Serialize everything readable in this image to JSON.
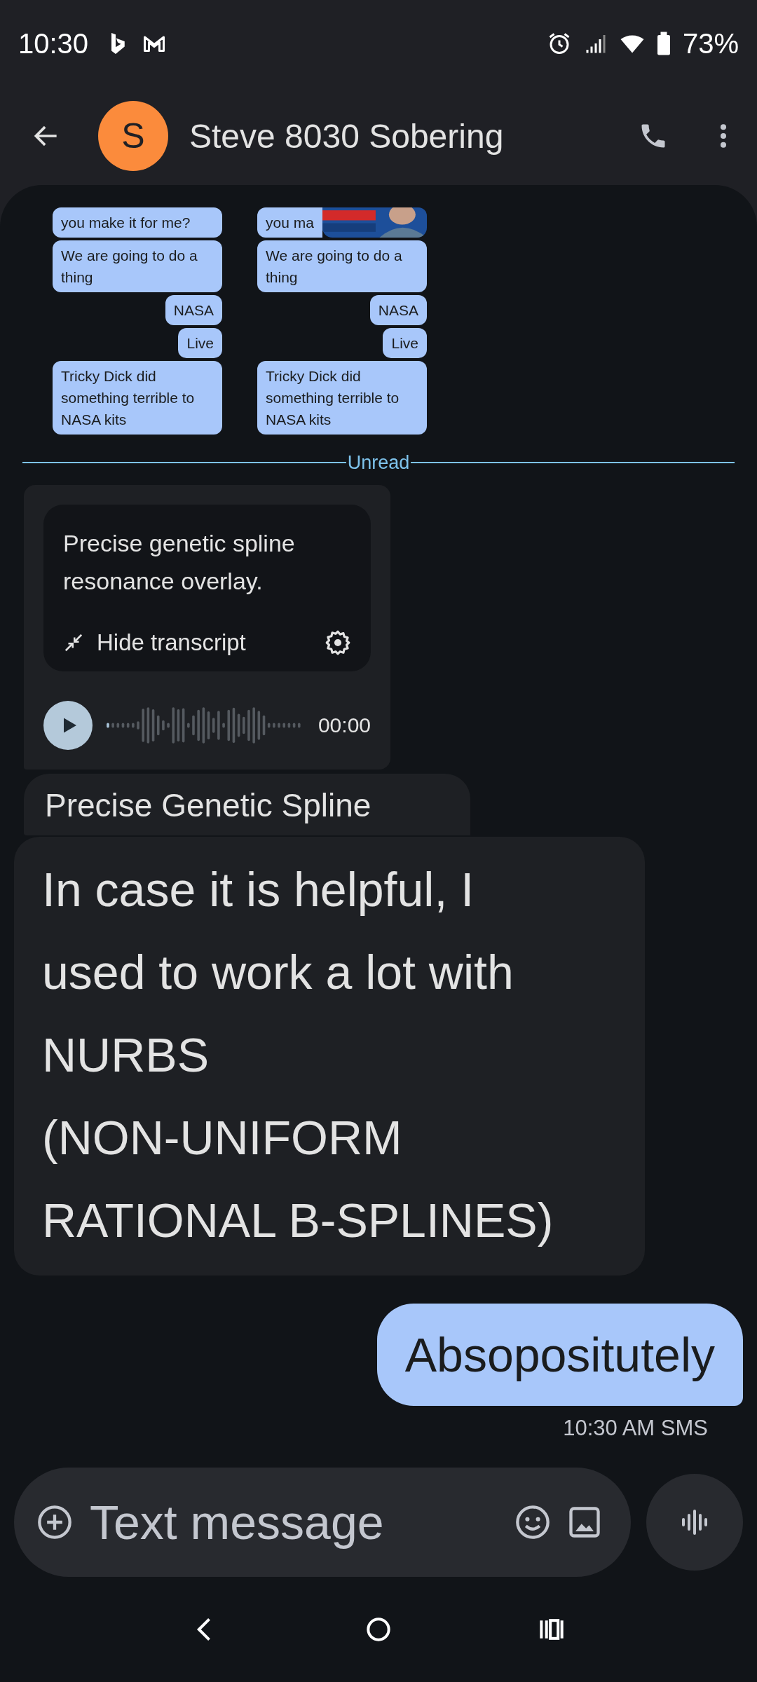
{
  "status_bar": {
    "time": "10:30",
    "battery": "73%"
  },
  "header": {
    "avatar_letter": "S",
    "contact": "Steve 8030 Sobering"
  },
  "shared_image": {
    "columns": [
      {
        "overlay_picture": false,
        "messages": [
          {
            "text": "you make it for me?",
            "kind": "wide"
          },
          {
            "text": "We are going to do a thing",
            "kind": "wide"
          },
          {
            "text": "NASA",
            "kind": "short"
          },
          {
            "text": "Live",
            "kind": "short"
          },
          {
            "text": "Tricky Dick did something terrible to NASA kits",
            "kind": "wide"
          }
        ]
      },
      {
        "overlay_picture": true,
        "messages": [
          {
            "text": "you ma",
            "kind": "wide"
          },
          {
            "text": "We are going to do a thing",
            "kind": "wide"
          },
          {
            "text": "NASA",
            "kind": "short"
          },
          {
            "text": "Live",
            "kind": "short"
          },
          {
            "text": "Tricky Dick did something terrible to NASA kits",
            "kind": "wide"
          }
        ]
      }
    ]
  },
  "divider": "Unread",
  "audio_message": {
    "transcript": "Precise genetic spline resonance overlay.",
    "hide_label": "Hide transcript",
    "duration": "00:00"
  },
  "incoming": [
    "Precise Genetic Spline",
    "In case it is helpful, I used to work a lot with\nNURBS\n(NON-UNIFORM RATIONAL B-SPLINES)"
  ],
  "outgoing": {
    "text": "Absopositutely",
    "meta": "10:30 AM SMS"
  },
  "composer": {
    "placeholder": "Text message"
  }
}
